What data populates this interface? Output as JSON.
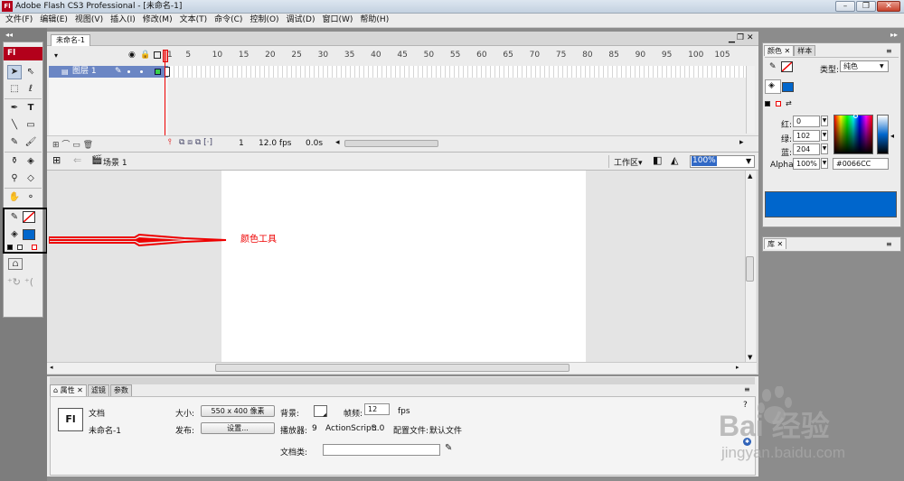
{
  "window": {
    "title": "Adobe Flash CS3 Professional - [未命名-1]",
    "app_badge": "Fl"
  },
  "menu": [
    "文件(F)",
    "编辑(E)",
    "视图(V)",
    "插入(I)",
    "修改(M)",
    "文本(T)",
    "命令(C)",
    "控制(O)",
    "调试(D)",
    "窗口(W)",
    "帮助(H)"
  ],
  "toolbox": {
    "badge": "Fl",
    "fill_color": "#0066cc"
  },
  "document": {
    "tab": "未命名-1"
  },
  "timeline": {
    "ruler": [
      "1",
      "5",
      "10",
      "15",
      "20",
      "25",
      "30",
      "35",
      "40",
      "45",
      "50",
      "55",
      "60",
      "65",
      "70",
      "75",
      "80",
      "85",
      "90",
      "95",
      "100",
      "105"
    ],
    "layer_name": "图层 1",
    "current_frame": "1",
    "fps": "12.0 fps",
    "time": "0.0s"
  },
  "editbar": {
    "scene": "场景 1",
    "workspace": "工作区▾",
    "zoom": "100%"
  },
  "annotation": {
    "label": "颜色工具"
  },
  "properties": {
    "tabs": [
      "属性",
      "滤镜",
      "参数"
    ],
    "doc_label": "文档",
    "doc_name": "未命名-1",
    "size_label": "大小:",
    "size_button": "550 x 400 像素",
    "bg_label": "背景:",
    "framerate_label": "帧频:",
    "framerate_value": "12",
    "fps_unit": "fps",
    "publish_label": "发布:",
    "settings_button": "设置...",
    "player_label": "播放器:",
    "player_value": "9",
    "as_label": "ActionScript:",
    "as_value": "3.0",
    "profile_label": "配置文件:",
    "profile_value": "默认文件",
    "class_label": "文档类:"
  },
  "color_panel": {
    "tabs": [
      "颜色",
      "样本"
    ],
    "type_label": "类型:",
    "type_value": "纯色",
    "red_label": "红:",
    "red_value": "0",
    "green_label": "绿:",
    "green_value": "102",
    "blue_label": "蓝:",
    "blue_value": "204",
    "alpha_label": "Alpha:",
    "alpha_value": "100%",
    "hex_value": "#0066CC",
    "current_color": "#0066cc"
  },
  "library_panel": {
    "tab": "库"
  },
  "watermark": {
    "brand": "Bai 经验",
    "url": "jingyan.baidu.com"
  }
}
